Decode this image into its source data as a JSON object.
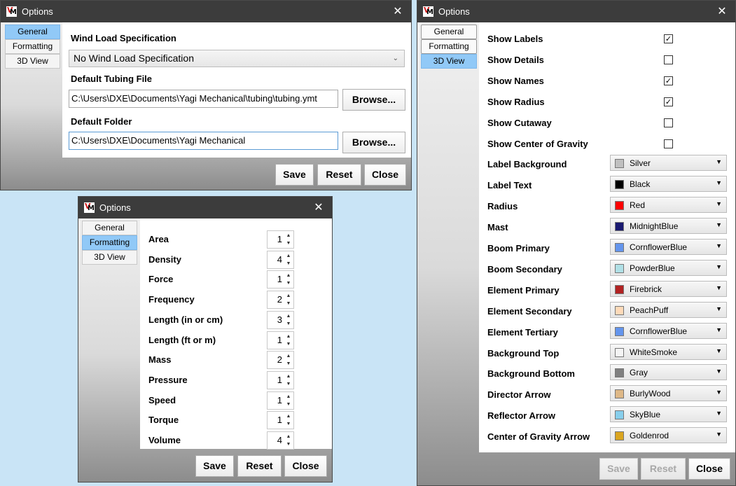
{
  "window_title": "Options",
  "tabs": [
    "General",
    "Formatting",
    "3D View"
  ],
  "buttons": {
    "save": "Save",
    "reset": "Reset",
    "close": "Close",
    "browse": "Browse..."
  },
  "general": {
    "wind_label": "Wind Load Specification",
    "wind_value": "No Wind Load Specification",
    "tubing_label": "Default Tubing File",
    "tubing_value": "C:\\Users\\DXE\\Documents\\Yagi Mechanical\\tubing\\tubing.ymt",
    "folder_label": "Default Folder",
    "folder_value": "C:\\Users\\DXE\\Documents\\Yagi Mechanical"
  },
  "formatting": {
    "rows": [
      {
        "label": "Area",
        "value": "1"
      },
      {
        "label": "Density",
        "value": "4"
      },
      {
        "label": "Force",
        "value": "1"
      },
      {
        "label": "Frequency",
        "value": "2"
      },
      {
        "label": "Length (in or cm)",
        "value": "3"
      },
      {
        "label": "Length (ft or m)",
        "value": "1"
      },
      {
        "label": "Mass",
        "value": "2"
      },
      {
        "label": "Pressure",
        "value": "1"
      },
      {
        "label": "Speed",
        "value": "1"
      },
      {
        "label": "Torque",
        "value": "1"
      },
      {
        "label": "Volume",
        "value": "4"
      }
    ]
  },
  "view3d": {
    "checks": [
      {
        "label": "Show Labels",
        "checked": true
      },
      {
        "label": "Show Details",
        "checked": false
      },
      {
        "label": "Show Names",
        "checked": true
      },
      {
        "label": "Show Radius",
        "checked": true
      },
      {
        "label": "Show Cutaway",
        "checked": false
      },
      {
        "label": "Show Center of Gravity",
        "checked": false
      }
    ],
    "colors": [
      {
        "label": "Label Background",
        "color": "Silver",
        "hex": "#C0C0C0"
      },
      {
        "label": "Label Text",
        "color": "Black",
        "hex": "#000000"
      },
      {
        "label": "Radius",
        "color": "Red",
        "hex": "#FF0000"
      },
      {
        "label": "Mast",
        "color": "MidnightBlue",
        "hex": "#191970"
      },
      {
        "label": "Boom Primary",
        "color": "CornflowerBlue",
        "hex": "#6495ED"
      },
      {
        "label": "Boom Secondary",
        "color": "PowderBlue",
        "hex": "#B0E0E6"
      },
      {
        "label": "Element Primary",
        "color": "Firebrick",
        "hex": "#B22222"
      },
      {
        "label": "Element Secondary",
        "color": "PeachPuff",
        "hex": "#FFDAB9"
      },
      {
        "label": "Element Tertiary",
        "color": "CornflowerBlue",
        "hex": "#6495ED"
      },
      {
        "label": "Background Top",
        "color": "WhiteSmoke",
        "hex": "#F5F5F5"
      },
      {
        "label": "Background Bottom",
        "color": "Gray",
        "hex": "#808080"
      },
      {
        "label": "Director Arrow",
        "color": "BurlyWood",
        "hex": "#DEB887"
      },
      {
        "label": "Reflector Arrow",
        "color": "SkyBlue",
        "hex": "#87CEEB"
      },
      {
        "label": "Center of Gravity Arrow",
        "color": "Goldenrod",
        "hex": "#DAA520"
      }
    ]
  }
}
